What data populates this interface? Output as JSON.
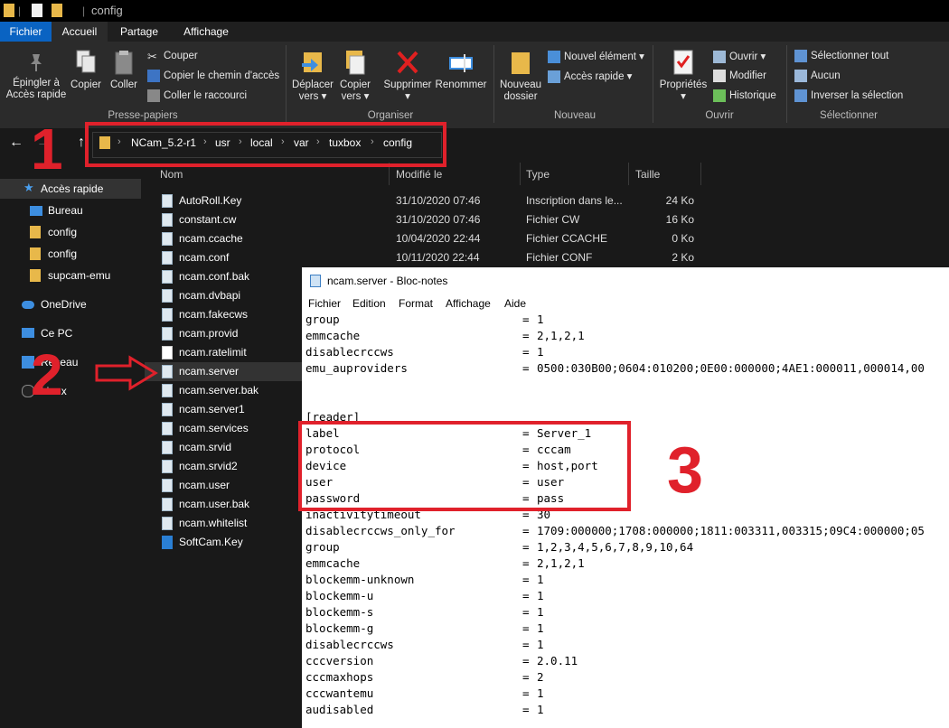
{
  "window": {
    "title": "config"
  },
  "tabs": [
    {
      "label": "Fichier"
    },
    {
      "label": "Accueil"
    },
    {
      "label": "Partage"
    },
    {
      "label": "Affichage"
    }
  ],
  "ribbon": {
    "pin_label_1": "Épingler à",
    "pin_label_2": "Accès rapide",
    "copy": "Copier",
    "paste": "Coller",
    "cut": "Couper",
    "copy_path": "Copier le chemin d'accès",
    "paste_shortcut": "Coller le raccourci",
    "group_clipboard": "Presse-papiers",
    "move_1": "Déplacer",
    "move_2": "vers",
    "copyto_1": "Copier",
    "copyto_2": "vers",
    "delete": "Supprimer",
    "rename": "Renommer",
    "group_organize": "Organiser",
    "newfolder_1": "Nouveau",
    "newfolder_2": "dossier",
    "new_item": "Nouvel élément",
    "easy_access": "Accès rapide",
    "group_new": "Nouveau",
    "properties": "Propriétés",
    "open": "Ouvrir",
    "edit": "Modifier",
    "history": "Historique",
    "group_open": "Ouvrir",
    "select_all": "Sélectionner tout",
    "select_none": "Aucun",
    "invert_selection": "Inverser la sélection",
    "group_select": "Sélectionner"
  },
  "breadcrumb": [
    "NCam_5.2-r1",
    "usr",
    "local",
    "var",
    "tuxbox",
    "config"
  ],
  "nav": [
    {
      "label": "Accès rapide",
      "icon": "star-icon"
    },
    {
      "label": "Bureau",
      "icon": "desktop-icon"
    },
    {
      "label": "config",
      "icon": "folder-icon"
    },
    {
      "label": "config",
      "icon": "folder-icon"
    },
    {
      "label": "supcam-emu",
      "icon": "folder-icon"
    },
    {
      "label": "OneDrive",
      "icon": "cloud-icon"
    },
    {
      "label": "Ce PC",
      "icon": "computer-icon"
    },
    {
      "label": "Réseau",
      "icon": "network-icon"
    },
    {
      "label": "Linux",
      "icon": "linux-icon"
    }
  ],
  "columns": {
    "name": "Nom",
    "modified": "Modifié le",
    "type": "Type",
    "size": "Taille"
  },
  "files": [
    {
      "name": "AutoRoll.Key",
      "date": "31/10/2020 07:46",
      "type": "Inscription dans le...",
      "size": "24 Ko"
    },
    {
      "name": "constant.cw",
      "date": "31/10/2020 07:46",
      "type": "Fichier CW",
      "size": "16 Ko"
    },
    {
      "name": "ncam.ccache",
      "date": "10/04/2020 22:44",
      "type": "Fichier CCACHE",
      "size": "0 Ko"
    },
    {
      "name": "ncam.conf",
      "date": "10/11/2020 22:44",
      "type": "Fichier CONF",
      "size": "2 Ko"
    },
    {
      "name": "ncam.conf.bak",
      "date": "",
      "type": "",
      "size": ""
    },
    {
      "name": "ncam.dvbapi",
      "date": "",
      "type": "",
      "size": ""
    },
    {
      "name": "ncam.fakecws",
      "date": "",
      "type": "",
      "size": ""
    },
    {
      "name": "ncam.provid",
      "date": "",
      "type": "",
      "size": ""
    },
    {
      "name": "ncam.ratelimit",
      "date": "",
      "type": "",
      "size": ""
    },
    {
      "name": "ncam.server",
      "date": "",
      "type": "",
      "size": ""
    },
    {
      "name": "ncam.server.bak",
      "date": "",
      "type": "",
      "size": ""
    },
    {
      "name": "ncam.server1",
      "date": "",
      "type": "",
      "size": ""
    },
    {
      "name": "ncam.services",
      "date": "",
      "type": "",
      "size": ""
    },
    {
      "name": "ncam.srvid",
      "date": "",
      "type": "",
      "size": ""
    },
    {
      "name": "ncam.srvid2",
      "date": "",
      "type": "",
      "size": ""
    },
    {
      "name": "ncam.user",
      "date": "",
      "type": "",
      "size": ""
    },
    {
      "name": "ncam.user.bak",
      "date": "",
      "type": "",
      "size": ""
    },
    {
      "name": "ncam.whitelist",
      "date": "",
      "type": "",
      "size": ""
    },
    {
      "name": "SoftCam.Key",
      "date": "",
      "type": "",
      "size": ""
    }
  ],
  "notepad": {
    "title": "ncam.server - Bloc-notes",
    "menu": [
      "Fichier",
      "Edition",
      "Format",
      "Affichage",
      "Aide"
    ],
    "lines": [
      {
        "k": "group",
        "v": "1"
      },
      {
        "k": "emmcache",
        "v": "2,1,2,1"
      },
      {
        "k": "disablecrccws",
        "v": "1"
      },
      {
        "k": "emu_auproviders",
        "v": "0500:030B00;0604:010200;0E00:000000;4AE1:000011,000014,00"
      },
      {
        "k": "",
        "v": ""
      },
      {
        "k": "",
        "v": ""
      },
      {
        "k": "[reader]",
        "v": "",
        "raw": true
      },
      {
        "k": "label",
        "v": "Server_1"
      },
      {
        "k": "protocol",
        "v": "cccam"
      },
      {
        "k": "device",
        "v": "host,port"
      },
      {
        "k": "user",
        "v": "user"
      },
      {
        "k": "password",
        "v": "pass"
      },
      {
        "k": "inactivitytimeout",
        "v": "30"
      },
      {
        "k": "disablecrccws_only_for",
        "v": "1709:000000;1708:000000;1811:003311,003315;09C4:000000;05"
      },
      {
        "k": "group",
        "v": "1,2,3,4,5,6,7,8,9,10,64"
      },
      {
        "k": "emmcache",
        "v": "2,1,2,1"
      },
      {
        "k": "blockemm-unknown",
        "v": "1"
      },
      {
        "k": "blockemm-u",
        "v": "1"
      },
      {
        "k": "blockemm-s",
        "v": "1"
      },
      {
        "k": "blockemm-g",
        "v": "1"
      },
      {
        "k": "disablecrccws",
        "v": "1"
      },
      {
        "k": "cccversion",
        "v": "2.0.11"
      },
      {
        "k": "cccmaxhops",
        "v": "2"
      },
      {
        "k": "cccwantemu",
        "v": "1"
      },
      {
        "k": "audisabled",
        "v": "1"
      }
    ]
  },
  "annotations": {
    "n1": "1",
    "n2": "2",
    "n3": "3"
  },
  "colors": {
    "accent": "#0a63c2",
    "annotation": "#e0212b",
    "background": "#191919",
    "selected": "#333333"
  }
}
